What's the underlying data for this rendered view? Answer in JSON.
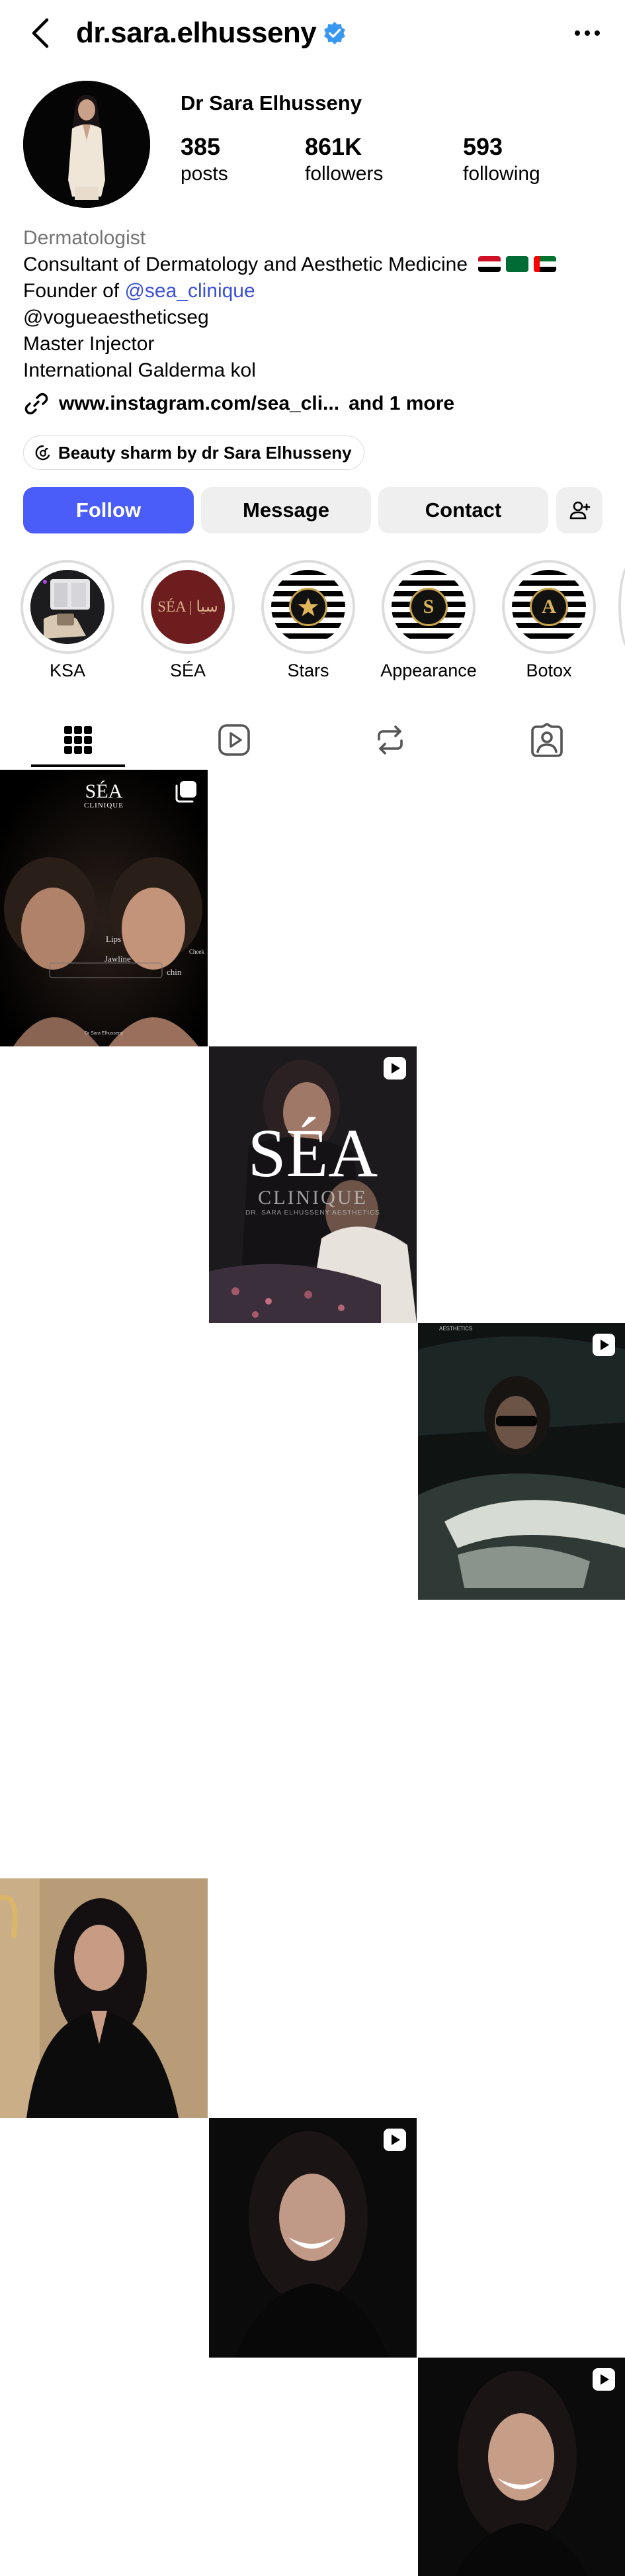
{
  "header": {
    "username": "dr.sara.elhusseny",
    "verified": true,
    "accent_color": "#3897f0"
  },
  "profile": {
    "display_name": "Dr Sara Elhusseny",
    "stats": [
      {
        "value": "385",
        "label": "posts"
      },
      {
        "value": "861K",
        "label": "followers"
      },
      {
        "value": "593",
        "label": "following"
      }
    ]
  },
  "bio": {
    "category": "Dermatologist",
    "line1": "Consultant of Dermatology  and Aesthetic Medicine",
    "line2_prefix": "Founder of ",
    "line2_mention": "@sea_clinique",
    "line3": "@vogueaestheticseg",
    "line4": "Master Injector",
    "line5": "International Galderma kol",
    "link_text": "www.instagram.com/sea_cli...",
    "link_more": "and 1 more",
    "threads_chip": "Beauty sharm by dr Sara Elhusseny"
  },
  "actions": {
    "follow": "Follow",
    "message": "Message",
    "contact": "Contact",
    "follow_color": "#4a5df9"
  },
  "highlights": [
    {
      "label": "KSA"
    },
    {
      "label": "SÉA",
      "cover_text": "SÉA | سيا"
    },
    {
      "label": "Stars"
    },
    {
      "label": "Appearance",
      "cover_text": "S"
    },
    {
      "label": "Botox",
      "cover_text": "A"
    }
  ],
  "grid": {
    "tile1": {
      "brand": "SÉA",
      "brand_sub": "CLINIQUE",
      "tags": [
        "Lips",
        "Jawline",
        "chin",
        "Cheek"
      ],
      "watermark": "Dr Sara Elhusseny"
    },
    "tile2": {
      "brand": "SÉA",
      "brand_sub": "CLINIQUE",
      "tagline": "DR. SARA ELHUSSENY AESTHETICS"
    },
    "tile3": {
      "caption": "AESTHETICS"
    }
  },
  "icons": {
    "back": "chevron-left-icon",
    "more": "more-horizontal-icon",
    "link": "link-icon",
    "threads": "threads-icon",
    "add_person": "add-person-icon",
    "tab_grid": "grid-icon",
    "tab_reels": "reels-icon",
    "tab_reposts": "repost-icon",
    "tab_tagged": "tagged-icon"
  }
}
